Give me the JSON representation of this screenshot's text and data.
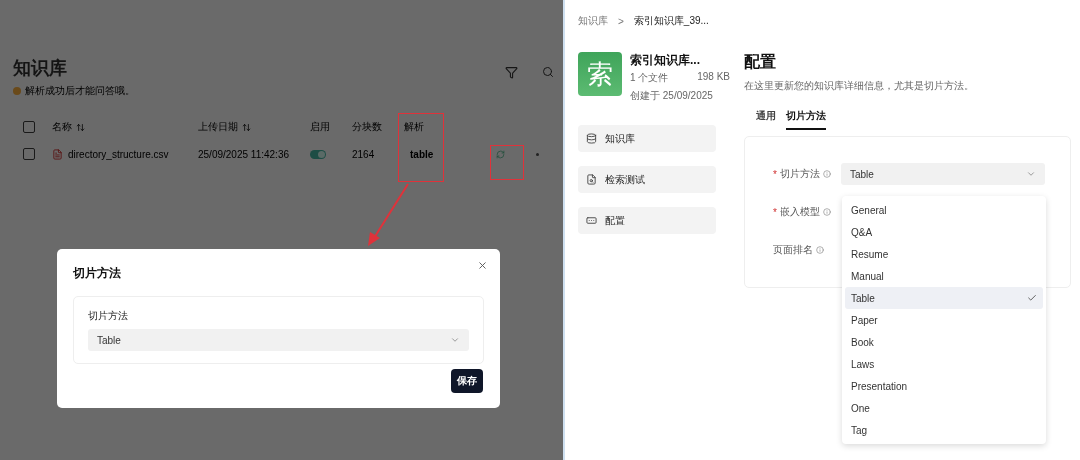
{
  "knowledge_list": {
    "title": "知识库",
    "subtitle": "解析成功后才能问答哦。",
    "select_all": {
      "checked": false
    },
    "columns": [
      {
        "label": "名称",
        "sortable": true
      },
      {
        "label": "上传日期",
        "sortable": true
      },
      {
        "label": "启用",
        "sortable": false
      },
      {
        "label": "分块数",
        "sortable": false
      },
      {
        "label": "解析",
        "sortable": false
      }
    ],
    "rows": [
      {
        "checked": false,
        "name": "directory_structure.csv",
        "uploaded": "25/09/2025 11:42:36",
        "enabled": true,
        "chunks": "2164",
        "parser": "table"
      }
    ]
  },
  "modal": {
    "title": "切片方法",
    "field_label": "切片方法",
    "value": "Table",
    "save_button": "保存"
  },
  "detail": {
    "breadcrumb": [
      "知识库",
      "索引知识库_39..."
    ],
    "breadcrumb_separator": ">",
    "kb": {
      "avatar": "索",
      "name": "索引知识库...",
      "files": "1 个文件",
      "size": "198 KB",
      "created": "创建于 25/09/2025"
    },
    "nav": [
      {
        "label": "知识库"
      },
      {
        "label": "检索测试"
      },
      {
        "label": "配置"
      }
    ],
    "title": "配置",
    "description": "在这里更新您的知识库详细信息，尤其是切片方法。",
    "tabs": [
      {
        "label": "通用",
        "selected": false
      },
      {
        "label": "切片方法",
        "selected": true
      }
    ],
    "form": [
      {
        "label": "切片方法",
        "required_mark": "*",
        "value": "Table"
      },
      {
        "label": "嵌入模型",
        "required_mark": "*"
      },
      {
        "label": "页面排名"
      }
    ],
    "dropdown": [
      {
        "label": "General",
        "selected": false
      },
      {
        "label": "Q&A",
        "selected": false
      },
      {
        "label": "Resume",
        "selected": false
      },
      {
        "label": "Manual",
        "selected": false
      },
      {
        "label": "Table",
        "selected": true
      },
      {
        "label": "Paper",
        "selected": false
      },
      {
        "label": "Book",
        "selected": false
      },
      {
        "label": "Laws",
        "selected": false
      },
      {
        "label": "Presentation",
        "selected": false
      },
      {
        "label": "One",
        "selected": false
      },
      {
        "label": "Tag",
        "selected": false
      }
    ]
  }
}
